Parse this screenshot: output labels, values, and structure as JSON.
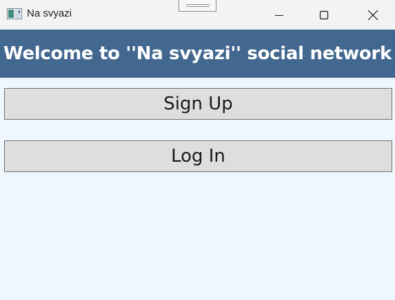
{
  "window": {
    "title": "Na svyazi",
    "controls": [
      "minimize-icon",
      "maximize-icon",
      "close-icon"
    ]
  },
  "header": {
    "title": "Welcome to ''Na svyazi'' social network"
  },
  "buttons": {
    "signup_label": "Sign Up",
    "login_label": "Log In"
  },
  "colors": {
    "header_bg": "#43688f",
    "content_bg": "#eff6fe",
    "button_bg": "#dedede",
    "titlebar_bg": "#f3f3f3"
  }
}
